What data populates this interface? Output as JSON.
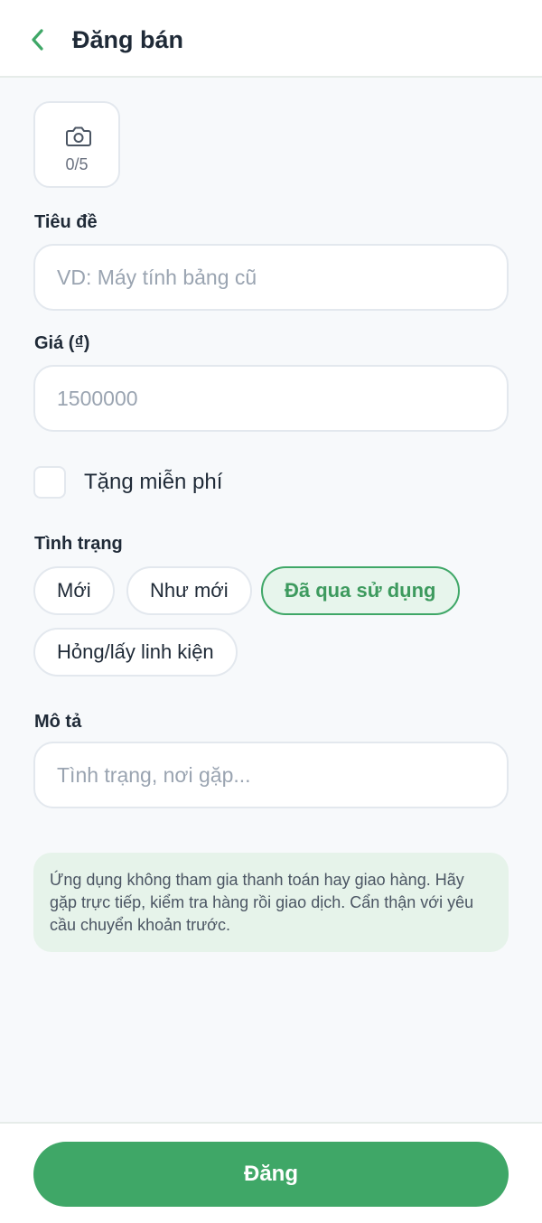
{
  "header": {
    "title": "Đăng bán",
    "back_icon": "chevron-left-icon"
  },
  "photos": {
    "icon": "camera-icon",
    "count": "0/5"
  },
  "fields": {
    "title_label": "Tiêu đề",
    "title_placeholder": "VD: Máy tính bảng cũ",
    "title_value": "",
    "price_label": "Giá (₫)",
    "price_placeholder": "1500000",
    "price_value": "",
    "free_label": "Tặng miễn phí",
    "free_checked": false,
    "condition_label": "Tình trạng",
    "conditions": [
      {
        "label": "Mới",
        "selected": false
      },
      {
        "label": "Như mới",
        "selected": false
      },
      {
        "label": "Đã qua sử dụng",
        "selected": true
      },
      {
        "label": "Hỏng/lấy linh kiện",
        "selected": false
      }
    ],
    "description_label": "Mô tả",
    "description_placeholder": "Tình trạng, nơi gặp...",
    "description_value": ""
  },
  "notice": {
    "text": "Ứng dụng không tham gia thanh toán hay giao hàng. Hãy gặp trực tiếp, kiểm tra hàng rồi giao dịch. Cẩn thận với yêu cầu chuyển khoản trước."
  },
  "footer": {
    "submit_label": "Đăng"
  },
  "colors": {
    "accent": "#3fa767",
    "background": "#f7f9fb",
    "notice_bg": "#e6f3ea"
  }
}
